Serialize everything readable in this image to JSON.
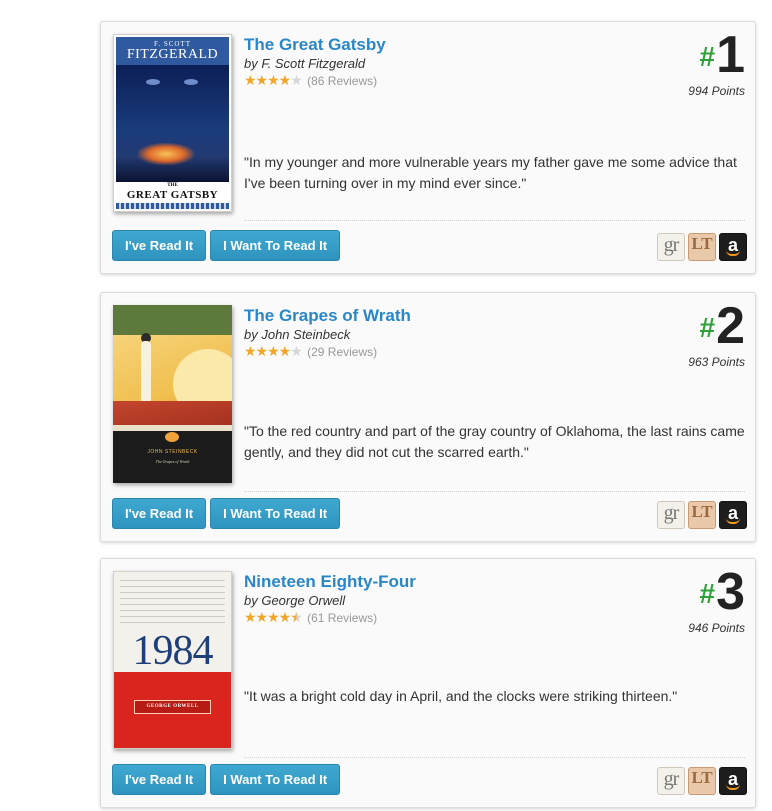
{
  "colors": {
    "title_link": "#2a87c7",
    "button": "#3fa8d0",
    "rank_hash": "#2fa13a",
    "star": "#f1a628"
  },
  "buttons": {
    "read": "I've Read It",
    "want": "I Want To Read It"
  },
  "stores": {
    "goodreads": "gr",
    "librarything": "LT",
    "amazon": "a"
  },
  "books": [
    {
      "rank_hash": "#",
      "rank": "1",
      "title": "The Great Gatsby",
      "author": "by F. Scott Fitzgerald",
      "rating_stars": 4,
      "reviews": "(86 Reviews)",
      "points": "994 Points",
      "quote": "\"In my younger and more vulnerable years my father gave me some advice that I've been turning over in my mind ever since.\"",
      "cover": {
        "author_small": "F. SCOTT",
        "author_big": "FITZGERALD",
        "the": "THE",
        "title": "GREAT GATSBY"
      }
    },
    {
      "rank_hash": "#",
      "rank": "2",
      "title": "The Grapes of Wrath",
      "author": "by John Steinbeck",
      "rating_stars": 4,
      "reviews": "(29 Reviews)",
      "points": "963 Points",
      "quote": "\"To the red country and part of the gray country of Oklahoma, the last rains came gently, and they did not cut the scarred earth.\"",
      "cover": {
        "author": "JOHN STEINBECK",
        "title": "The Grapes of Wrath"
      }
    },
    {
      "rank_hash": "#",
      "rank": "3",
      "title": "Nineteen Eighty-Four",
      "author": "by George Orwell",
      "rating_stars": 4.5,
      "reviews": "(61 Reviews)",
      "points": "946 Points",
      "quote": "\"It was a bright cold day in April, and the clocks were striking thirteen.\"",
      "cover": {
        "year": "1984",
        "author": "GEORGE ORWELL"
      }
    }
  ]
}
